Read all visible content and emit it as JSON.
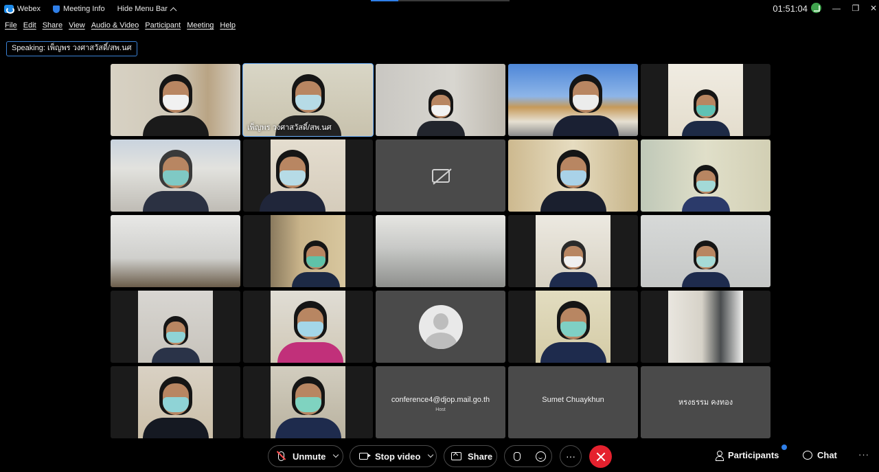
{
  "titlebar": {
    "app_name": "Webex",
    "meeting_info": "Meeting Info",
    "hide_menu": "Hide Menu Bar",
    "time": "01:51:04",
    "minimize": "—",
    "restore": "❐",
    "close": "✕"
  },
  "menu": [
    "File",
    "Edit",
    "Share",
    "View",
    "Audio & Video",
    "Participant",
    "Meeting",
    "Help"
  ],
  "speaking": "Speaking: เพ็ญพร วงศาสวัสดิ์/สพ.นศ",
  "active_speaker_label": "เพ็ญพร วงศาสวัสดิ์/สพ.นศ",
  "named_tiles": {
    "host_email": "conference4@djop.mail.go.th",
    "host_tag": "Host",
    "participant_2": "Sumet Chuaykhun",
    "participant_3": "หรงธรรม คงทอง"
  },
  "colors": {
    "accent_blue": "#2f7fe8",
    "leave_red": "#e5212e",
    "tile_gray": "#4a4a4a"
  },
  "toolbar": {
    "unmute": "Unmute",
    "stop_video": "Stop video",
    "share": "Share",
    "participants": "Participants",
    "chat": "Chat",
    "more": "···"
  }
}
